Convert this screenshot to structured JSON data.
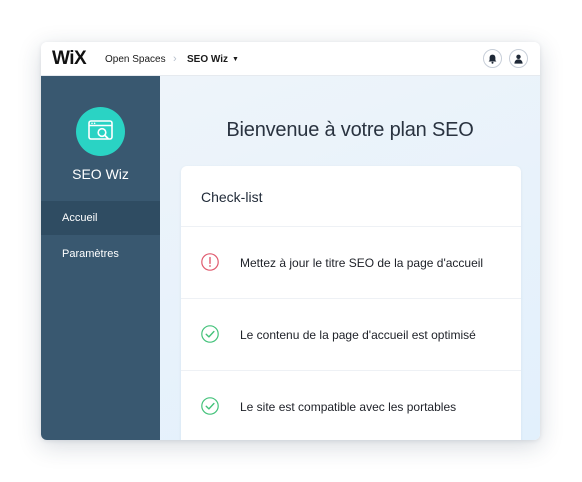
{
  "topbar": {
    "logo": "WiX",
    "breadcrumb": [
      "Open Spaces",
      "SEO Wiz"
    ],
    "separator": "›",
    "caret": "▼",
    "icons": [
      "bell-icon",
      "user-icon"
    ]
  },
  "sidebar": {
    "app_name": "SEO Wiz",
    "app_icon": "seo-browser-search-icon",
    "items": [
      {
        "label": "Accueil",
        "active": true
      },
      {
        "label": "Paramètres",
        "active": false
      }
    ]
  },
  "main": {
    "title": "Bienvenue à votre plan SEO",
    "checklist": {
      "title": "Check-list",
      "items": [
        {
          "label": "Mettez à jour le titre SEO de la page d'accueil",
          "status": "warning"
        },
        {
          "label": "Le contenu de la page d'accueil est optimisé",
          "status": "done"
        },
        {
          "label": "Le site est compatible avec les portables",
          "status": "done"
        }
      ]
    }
  },
  "colors": {
    "sidebar": "#395870",
    "sidebar_active": "#2f4c62",
    "accent": "#2ad3c4",
    "warning": "#e05a6e",
    "done": "#43c27a"
  }
}
